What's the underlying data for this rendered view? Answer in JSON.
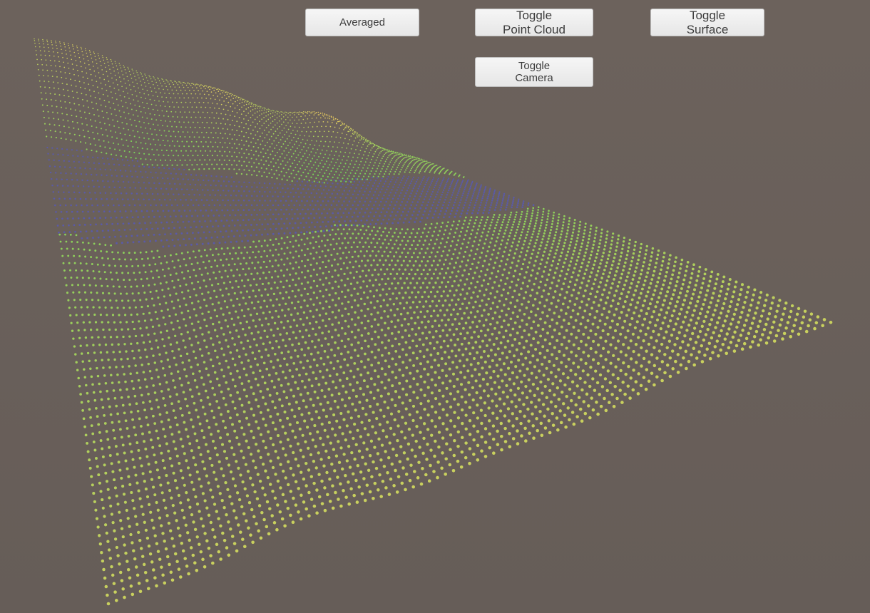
{
  "buttons": {
    "averaged": "Averaged",
    "point_cloud": "Toggle\nPoint Cloud",
    "surface": "Toggle\nSurface",
    "camera": "Toggle\nCamera"
  },
  "colors": {
    "background": "#6a605a",
    "terrain_low": "#6fcf5a",
    "terrain_high": "#f0d060",
    "water": "#5a5aa8"
  },
  "scene": {
    "visible_layer": "point cloud",
    "legend": "none"
  }
}
